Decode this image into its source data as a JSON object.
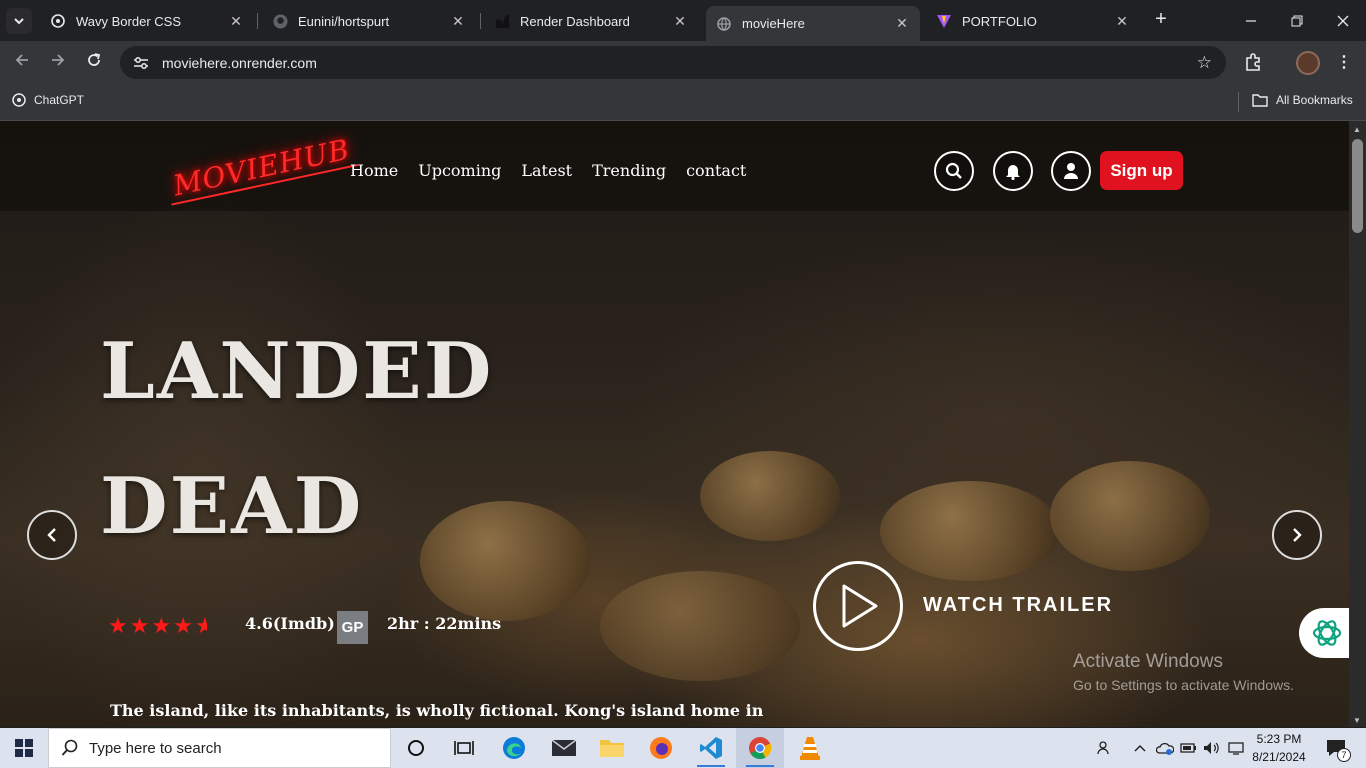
{
  "browser": {
    "tabs": [
      {
        "title": "Wavy Border CSS",
        "icon": "chatgpt-icon"
      },
      {
        "title": "Eunini/hortspurt",
        "icon": "github-icon"
      },
      {
        "title": "Render Dashboard",
        "icon": "render-icon"
      },
      {
        "title": "movieHere",
        "icon": "globe-icon",
        "active": true
      },
      {
        "title": "PORTFOLIO",
        "icon": "vite-icon"
      }
    ],
    "url": "moviehere.onrender.com",
    "bookmarks": {
      "left": "ChatGPT",
      "right": "All Bookmarks"
    }
  },
  "site": {
    "logo": "MOVIEHUB",
    "nav": [
      "Home",
      "Upcoming",
      "Latest",
      "Trending",
      "contact"
    ],
    "signup": "Sign up",
    "hero": {
      "title_line1": "LANDED",
      "title_line2": "DEAD",
      "stars": 4.5,
      "rating": "4.6(Imdb)",
      "badge": "GP",
      "duration": "2hr : 22mins",
      "watch": "WATCH TRAILER",
      "description": "The island, like its inhabitants, is wholly fictional. Kong's island home in"
    },
    "colors": {
      "accent": "#e0121f",
      "neon": "#ff2a2a"
    }
  },
  "watermark": {
    "line1": "Activate Windows",
    "line2": "Go to Settings to activate Windows."
  },
  "taskbar": {
    "search_placeholder": "Type here to search",
    "time": "5:23 PM",
    "date": "8/21/2024",
    "notifications": "7"
  }
}
